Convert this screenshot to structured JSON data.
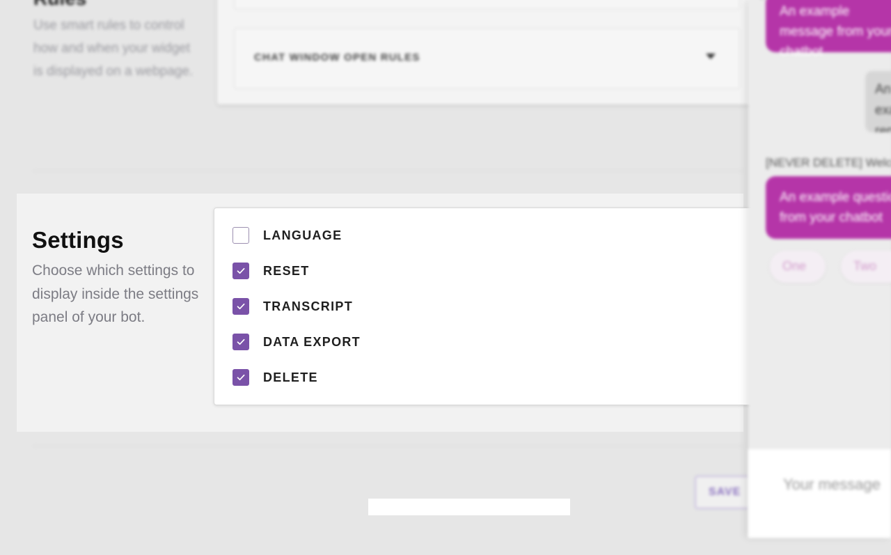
{
  "rules_section": {
    "heading_fragment": "Rules",
    "description": "Use smart rules to control how and when your widget is displayed on a webpage.",
    "chat_window_open_rules_label": "CHAT WINDOW OPEN RULES"
  },
  "settings_section": {
    "title": "Settings",
    "description": "Choose which settings to display inside the settings panel of your bot.",
    "options": [
      {
        "label": "LANGUAGE",
        "checked": false
      },
      {
        "label": "RESET",
        "checked": true
      },
      {
        "label": "TRANSCRIPT",
        "checked": true
      },
      {
        "label": "DATA EXPORT",
        "checked": true
      },
      {
        "label": "DELETE",
        "checked": true
      }
    ]
  },
  "footer": {
    "save_label": "SAVE"
  },
  "chat_preview": {
    "bot_message_1": "An example message from your chatbot",
    "user_message": "An example reply to your chatbot",
    "section_label": "[NEVER DELETE] Welcome",
    "bot_message_2": "An example question from your chatbot",
    "quick_replies": [
      "One",
      "Two"
    ],
    "composer_placeholder": "Your message"
  },
  "colors": {
    "accent_purple": "#7a52a8",
    "bot_bubble_magenta": "#b535a8",
    "page_background": "#e6e6e6"
  }
}
